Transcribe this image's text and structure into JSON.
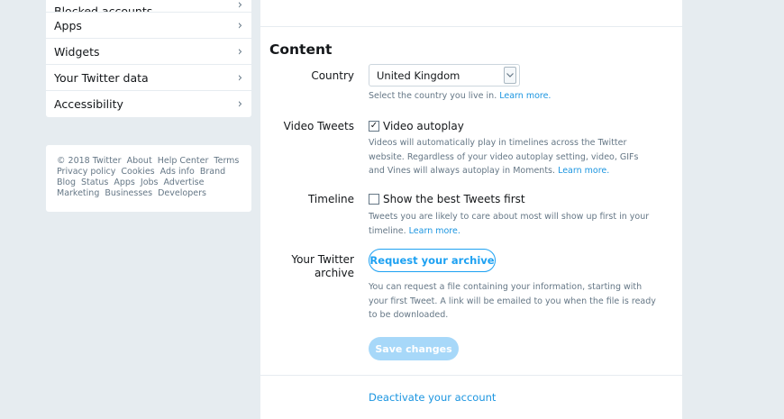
{
  "sidebar": {
    "items": [
      {
        "label": "Blocked accounts"
      },
      {
        "label": "Apps"
      },
      {
        "label": "Widgets"
      },
      {
        "label": "Your Twitter data"
      },
      {
        "label": "Accessibility"
      }
    ],
    "chevron": "›",
    "footer": {
      "copyright": "© 2018 Twitter",
      "links": [
        "About",
        "Help Center",
        "Terms",
        "Privacy policy",
        "Cookies",
        "Ads info",
        "Brand",
        "Blog",
        "Status",
        "Apps",
        "Jobs",
        "Advertise",
        "Marketing",
        "Businesses",
        "Developers"
      ]
    }
  },
  "content": {
    "title": "Content",
    "country": {
      "label": "Country",
      "value": "United Kingdom",
      "help": "Select the country you live in.",
      "learn_more": "Learn more."
    },
    "video_tweets": {
      "label": "Video Tweets",
      "option": "Video autoplay",
      "checked": true,
      "check_glyph": "✓",
      "help": "Videos will automatically play in timelines across the Twitter website. Regardless of your video autoplay setting, video, GIFs and Vines will always autoplay in Moments.",
      "learn_more": "Learn more."
    },
    "timeline": {
      "label": "Timeline",
      "option": "Show the best Tweets first",
      "checked": false,
      "help": "Tweets you are likely to care about most will show up first in your timeline.",
      "learn_more": "Learn more."
    },
    "archive": {
      "label_line1": "Your Twitter",
      "label_line2": "archive",
      "button": "Request your archive",
      "help": "You can request a file containing your information, starting with your first Tweet. A link will be emailed to you when the file is ready to be downloaded."
    },
    "save_button": "Save changes",
    "deactivate": "Deactivate your account"
  },
  "colors": {
    "background": "#e6ecf0",
    "accent": "#1da1f2",
    "link": "#1b95e0",
    "disabled_button": "#a7d8f9"
  },
  "icons": {
    "select_arrow": "chevron-down-icon",
    "sidebar_chevron": "chevron-right-icon",
    "checkbox_check": "check-icon"
  }
}
